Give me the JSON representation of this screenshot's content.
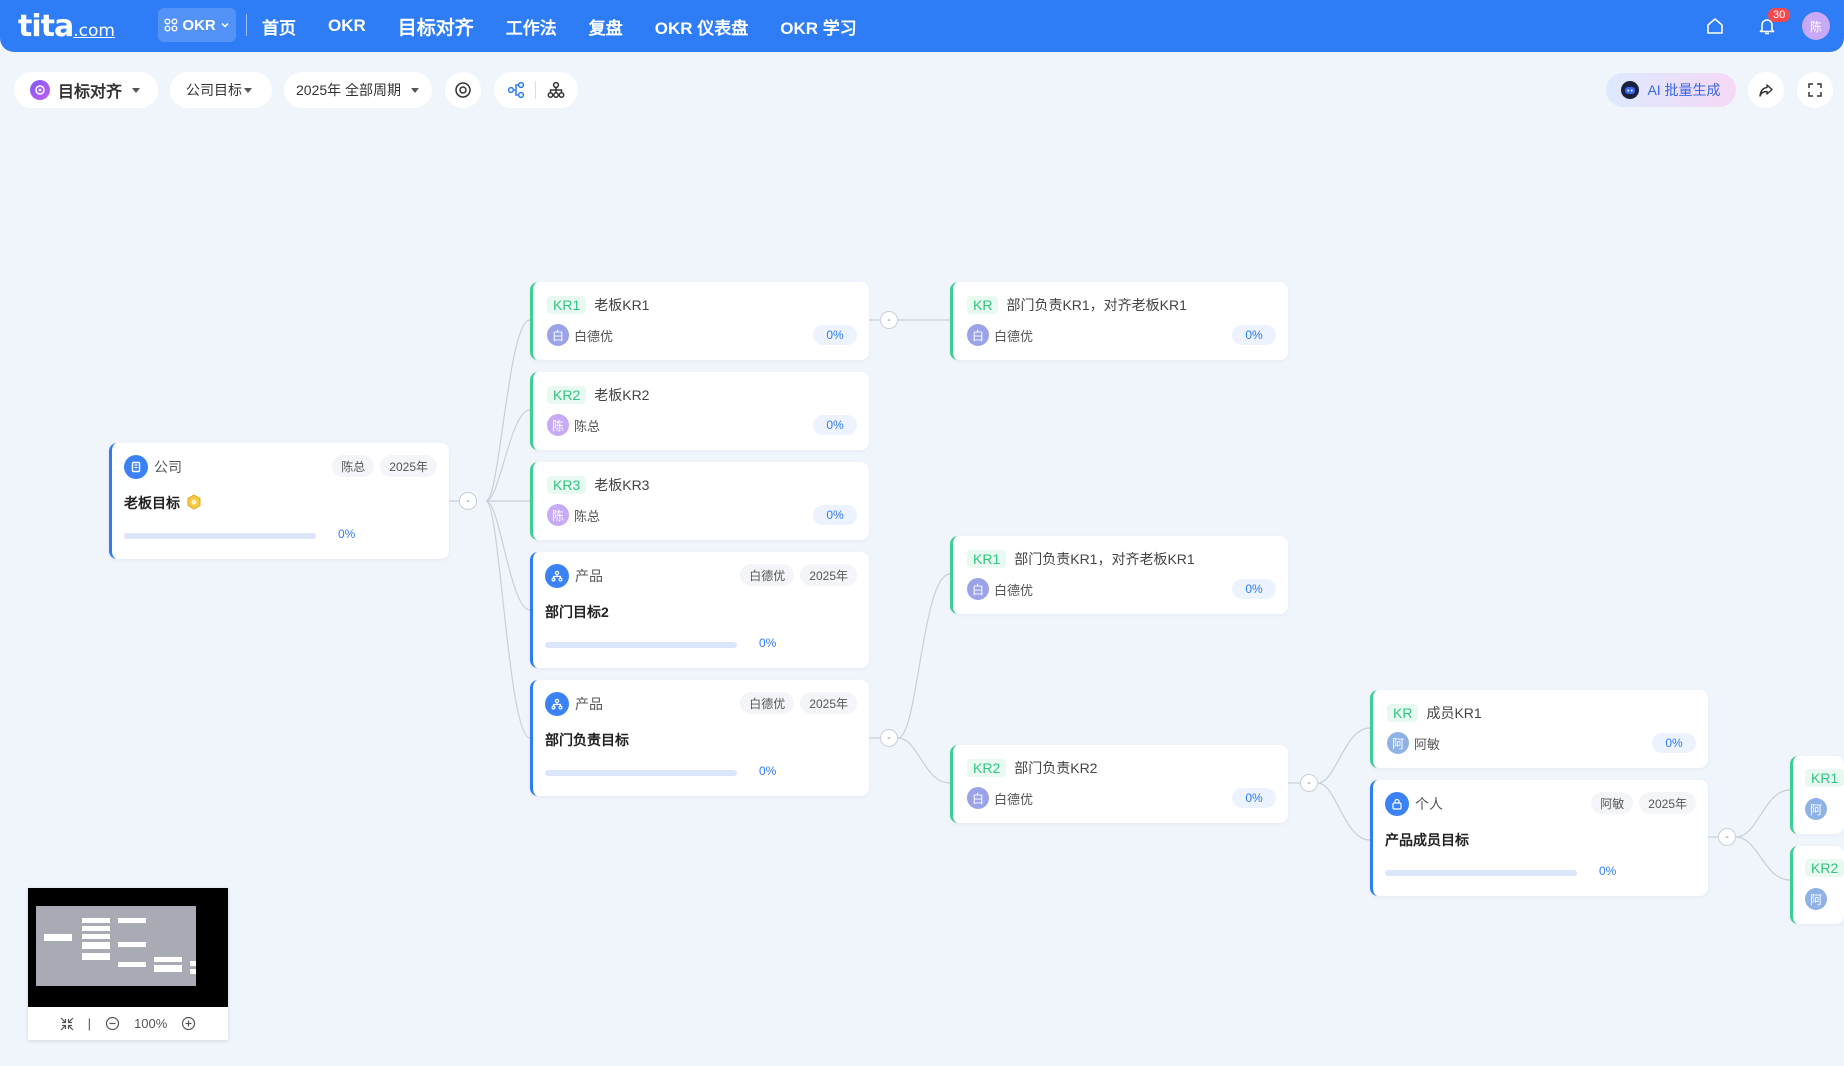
{
  "header": {
    "logo": "tita",
    "logo_suffix": ".com",
    "app_switch": "OKR",
    "nav": [
      "首页",
      "OKR",
      "目标对齐",
      "工作法",
      "复盘",
      "OKR 仪表盘",
      "OKR 学习"
    ],
    "notification_count": "30",
    "user_initial": "陈"
  },
  "toolbar": {
    "view": "目标对齐",
    "scope": "公司目标",
    "period": "2025年 全部周期",
    "ai_button": "AI 批量生成"
  },
  "colors": {
    "primary": "#2e7cf6",
    "kr_green": "#3ccf91"
  },
  "root": {
    "type": "公司",
    "owner": "陈总",
    "year": "2025年",
    "title": "老板目标",
    "progress": "0%"
  },
  "level1_krs": [
    {
      "tag": "KR1",
      "title": "老板KR1",
      "owner": "白德优",
      "initial": "白",
      "progress": "0%"
    },
    {
      "tag": "KR2",
      "title": "老板KR2",
      "owner": "陈总",
      "initial": "陈",
      "progress": "0%"
    },
    {
      "tag": "KR3",
      "title": "老板KR3",
      "owner": "陈总",
      "initial": "陈",
      "progress": "0%"
    }
  ],
  "level1_objs": [
    {
      "type": "产品",
      "owner": "白德优",
      "year": "2025年",
      "title": "部门目标2",
      "progress": "0%"
    },
    {
      "type": "产品",
      "owner": "白德优",
      "year": "2025年",
      "title": "部门负责目标",
      "progress": "0%"
    }
  ],
  "level2": [
    {
      "tag": "KR",
      "title": "部门负责KR1，对齐老板KR1",
      "owner": "白德优",
      "initial": "白",
      "progress": "0%"
    },
    {
      "tag": "KR1",
      "title": "部门负责KR1，对齐老板KR1",
      "owner": "白德优",
      "initial": "白",
      "progress": "0%"
    },
    {
      "tag": "KR2",
      "title": "部门负责KR2",
      "owner": "白德优",
      "initial": "白",
      "progress": "0%"
    }
  ],
  "level3_kr": {
    "tag": "KR",
    "title": "成员KR1",
    "owner": "阿敏",
    "initial": "阿",
    "progress": "0%"
  },
  "level3_obj": {
    "type": "个人",
    "owner": "阿敏",
    "year": "2025年",
    "title": "产品成员目标",
    "progress": "0%"
  },
  "level4": [
    {
      "tag": "KR1",
      "initial": "阿"
    },
    {
      "tag": "KR2",
      "initial": "阿"
    }
  ],
  "collapse_symbol": "-",
  "minimap": {
    "zoom": "100%",
    "divider": "|"
  }
}
